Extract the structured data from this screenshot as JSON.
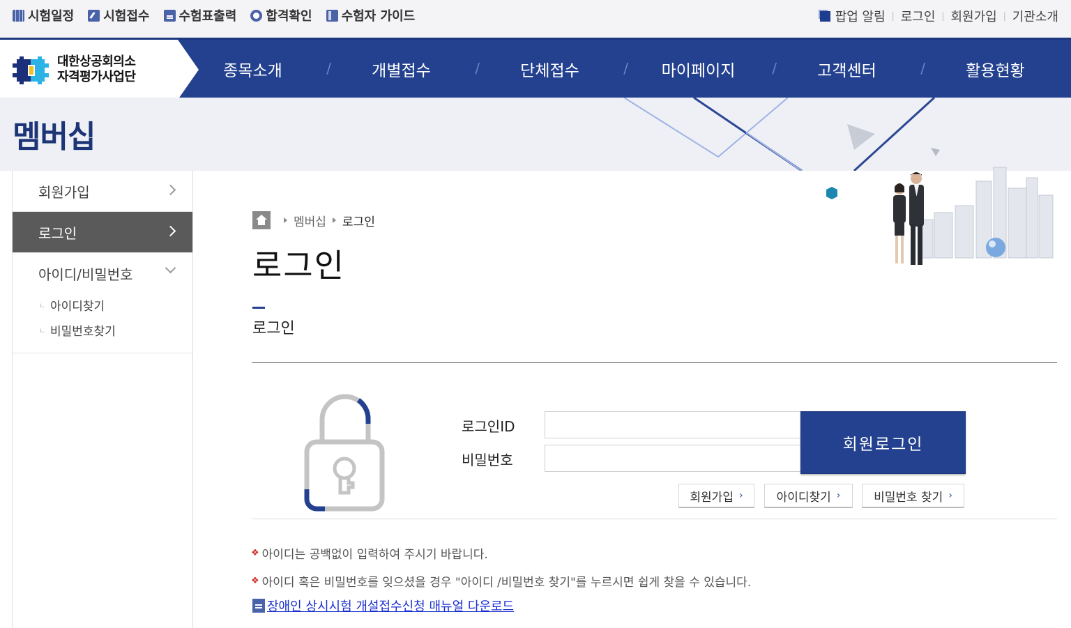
{
  "topbar": {
    "left_items": [
      {
        "label": "시험일정",
        "icon": "calendar-icon"
      },
      {
        "label": "시험접수",
        "icon": "pen-icon"
      },
      {
        "label": "수험표출력",
        "icon": "document-icon"
      },
      {
        "label": "합격확인",
        "icon": "medal-icon"
      },
      {
        "label": "수험자 가이드",
        "icon": "book-icon"
      }
    ],
    "right_items": {
      "popup": "팝업 알림",
      "login": "로그인",
      "signup": "회원가입",
      "about": "기관소개"
    }
  },
  "logo": {
    "line1": "대한상공회의소",
    "line2": "자격평가사업단"
  },
  "nav": {
    "items": [
      "종목소개",
      "개별접수",
      "단체접수",
      "마이페이지",
      "고객센터",
      "활용현황"
    ]
  },
  "banner": {
    "title": "멤버십"
  },
  "sidebar": {
    "signup": "회원가입",
    "login": "로그인",
    "find_group": "아이디/비밀번호",
    "find_id": "아이디찾기",
    "find_pw": "비밀번호찾기"
  },
  "breadcrumb": {
    "section": "멤버십",
    "current": "로그인"
  },
  "page": {
    "title": "로그인",
    "section_title": "로그인"
  },
  "form": {
    "id_label": "로그인ID",
    "pw_label": "비밀번호",
    "id_value": "",
    "pw_value": "",
    "login_button": "회원로그인",
    "signup_button": "회원가입",
    "find_id_button": "아이디찾기",
    "find_pw_button": "비밀번호 찾기"
  },
  "notices": {
    "line1": "아이디는 공백없이 입력하여 주시기 바랍니다.",
    "line2": "아이디 혹은 비밀번호를 잊으셨을 경우 \"아이디 /비밀번호 찾기\"를 누르시면 쉽게 찾을 수 있습니다.",
    "download_link": "장애인 상시시험 개설접수신청 매뉴얼 다운로드"
  },
  "colors": {
    "brand": "#23418f",
    "sidebar_active": "#5a5a5a",
    "notice_bullet": "#d0322c",
    "link": "#1a2fd0"
  }
}
